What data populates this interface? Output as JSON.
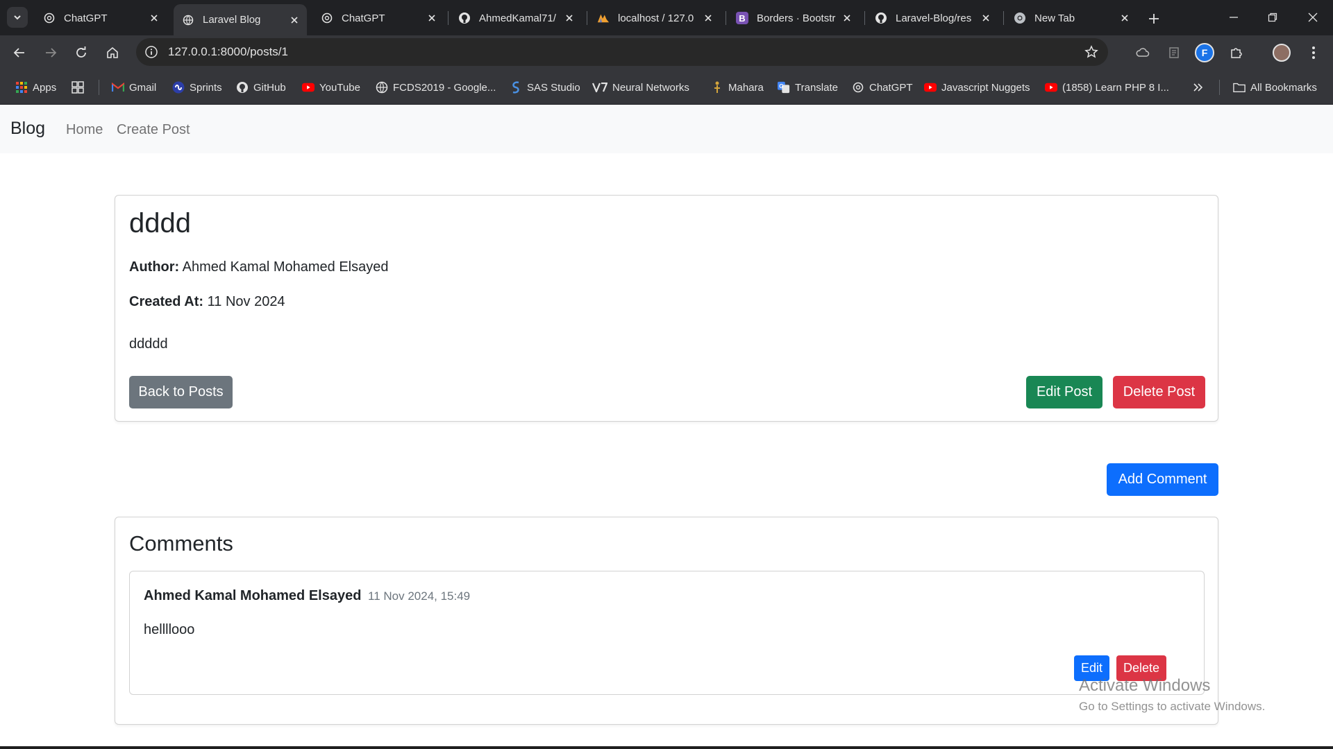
{
  "browser": {
    "tabs": [
      {
        "title": "ChatGPT",
        "icon": "chatgpt-icon"
      },
      {
        "title": "Laravel Blog",
        "icon": "globe-icon",
        "active": true
      },
      {
        "title": "ChatGPT",
        "icon": "chatgpt-icon"
      },
      {
        "title": "AhmedKamal71/",
        "icon": "github-icon"
      },
      {
        "title": "localhost / 127.0",
        "icon": "phpmyadmin-icon"
      },
      {
        "title": "Borders · Bootstr",
        "icon": "bootstrap-icon"
      },
      {
        "title": "Laravel-Blog/res",
        "icon": "github-icon"
      },
      {
        "title": "New Tab",
        "icon": "chrome-icon"
      }
    ],
    "url": "127.0.0.1:8000/posts/1",
    "profile_initial": "F",
    "bookmarks": [
      {
        "label": "Apps",
        "icon": "apps-grid-icon"
      },
      {
        "label": "",
        "icon": "tab-groups-icon"
      },
      {
        "label": "Gmail",
        "icon": "gmail-icon"
      },
      {
        "label": "Sprints",
        "icon": "sprints-icon"
      },
      {
        "label": "GitHub",
        "icon": "github-icon"
      },
      {
        "label": "YouTube",
        "icon": "youtube-icon"
      },
      {
        "label": "FCDS2019 - Google...",
        "icon": "globe-icon"
      },
      {
        "label": "SAS Studio",
        "icon": "sas-icon"
      },
      {
        "label": "Neural Networks",
        "icon": "v7-icon"
      },
      {
        "label": "Mahara",
        "icon": "mahara-icon"
      },
      {
        "label": "Translate",
        "icon": "translate-icon"
      },
      {
        "label": "ChatGPT",
        "icon": "chatgpt-icon"
      },
      {
        "label": "Javascript Nuggets",
        "icon": "youtube-icon"
      },
      {
        "label": "(1858) Learn PHP 8 I...",
        "icon": "youtube-icon"
      }
    ],
    "all_bookmarks": "All Bookmarks"
  },
  "nav": {
    "brand": "Blog",
    "links": [
      "Home",
      "Create Post"
    ]
  },
  "post": {
    "title": "dddd",
    "author_label": "Author:",
    "author": "Ahmed Kamal Mohamed Elsayed",
    "created_label": "Created At:",
    "created_at": "11 Nov 2024",
    "body": "ddddd",
    "back_button": "Back to Posts",
    "edit_button": "Edit Post",
    "delete_button": "Delete Post"
  },
  "add_comment_button": "Add Comment",
  "comments": {
    "heading": "Comments",
    "items": [
      {
        "author": "Ahmed Kamal Mohamed Elsayed",
        "date": "11 Nov 2024, 15:49",
        "body": "hellllooo",
        "edit_label": "Edit",
        "delete_label": "Delete"
      }
    ]
  },
  "watermark": {
    "line1": "Activate Windows",
    "line2": "Go to Settings to activate Windows."
  },
  "colors": {
    "primary": "#0d6efd",
    "success": "#198754",
    "danger": "#dc3545",
    "secondary": "#6c757d"
  }
}
